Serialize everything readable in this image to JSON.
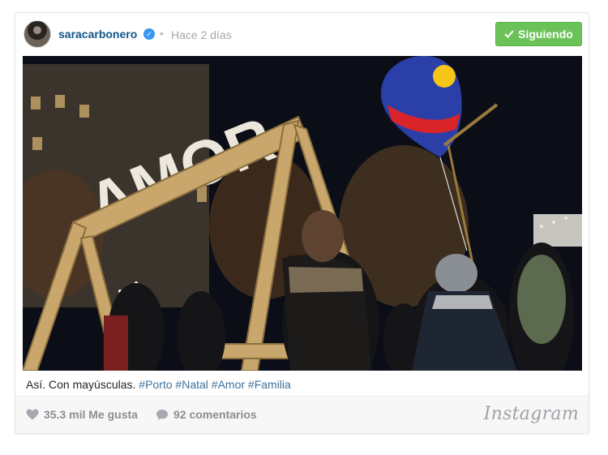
{
  "post": {
    "username": "saracarbonero",
    "verified_icon": "verified-check-icon",
    "separator": "•",
    "time": "Hace 2 días",
    "follow_button": "Siguiendo",
    "photo_sign_text": "AMOR",
    "caption_text": "Así. Con mayúsculas.",
    "hashtags": [
      "#Porto",
      "#Natal",
      "#Amor",
      "#Familia"
    ],
    "likes": "35.3 mil Me gusta",
    "comments": "92 comentarios",
    "brand": "Instagram"
  },
  "colors": {
    "follow_green": "#6bc259",
    "username_blue": "#125688",
    "hashtag_blue": "#3f729b",
    "muted_gray": "#8a8e93"
  }
}
